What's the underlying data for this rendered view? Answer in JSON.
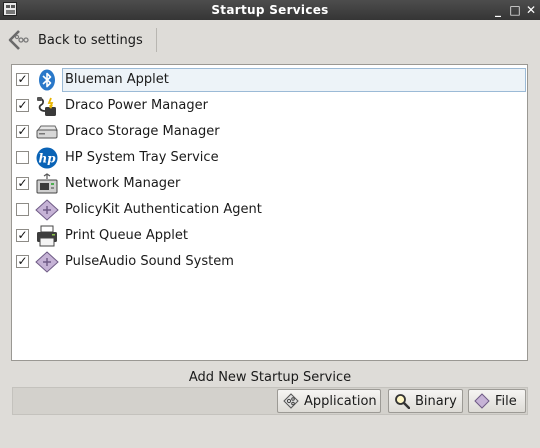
{
  "window": {
    "title": "Startup Services"
  },
  "toolbar": {
    "back_label": "Back to settings"
  },
  "services": [
    {
      "label": "Blueman Applet",
      "checked": true,
      "icon": "bluetooth-icon",
      "selected": true
    },
    {
      "label": "Draco Power Manager",
      "checked": true,
      "icon": "power-manager-icon",
      "selected": false
    },
    {
      "label": "Draco Storage Manager",
      "checked": true,
      "icon": "drive-icon",
      "selected": false
    },
    {
      "label": "HP System Tray Service",
      "checked": false,
      "icon": "hp-logo-icon",
      "selected": false
    },
    {
      "label": "Network Manager",
      "checked": true,
      "icon": "network-icon",
      "selected": false
    },
    {
      "label": "PolicyKit Authentication Agent",
      "checked": false,
      "icon": "diamond-app-icon",
      "selected": false
    },
    {
      "label": "Print Queue Applet",
      "checked": true,
      "icon": "printer-icon",
      "selected": false
    },
    {
      "label": "PulseAudio Sound System",
      "checked": true,
      "icon": "diamond-app-icon",
      "selected": false
    }
  ],
  "footer": {
    "add_label": "Add New Startup Service",
    "buttons": [
      {
        "label": "Application",
        "icon": "application-icon"
      },
      {
        "label": "Binary",
        "icon": "search-icon"
      },
      {
        "label": "File",
        "icon": "file-icon"
      }
    ]
  },
  "colors": {
    "titlebar": "#3c3c3c",
    "selection": "#edf3f8",
    "hp_blue": "#0a63b6",
    "bluetooth_blue": "#2a78c9"
  }
}
